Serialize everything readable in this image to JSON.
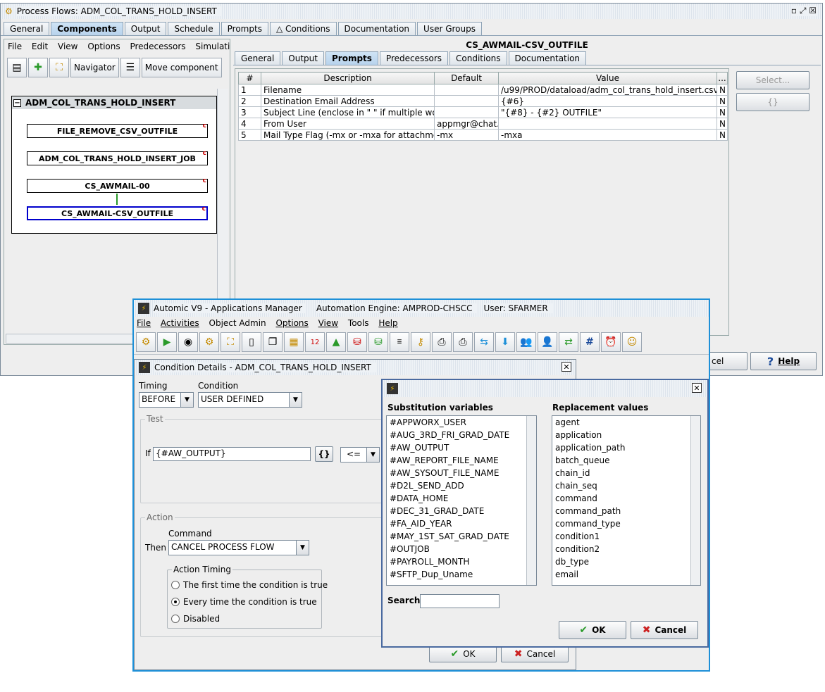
{
  "main": {
    "title": "Process Flows: ADM_COL_TRANS_HOLD_INSERT",
    "tabs": [
      "General",
      "Components",
      "Output",
      "Schedule",
      "Prompts",
      "Conditions",
      "Documentation",
      "User Groups"
    ],
    "left_menu": [
      "File",
      "Edit",
      "View",
      "Options",
      "Predecessors",
      "Simulation"
    ],
    "navigator_label": "Navigator",
    "move_label": "Move component",
    "flow_header": "ADM_COL_TRANS_HOLD_INSERT",
    "nodes": [
      "FILE_REMOVE_CSV_OUTFILE",
      "ADM_COL_TRANS_HOLD_INSERT_JOB",
      "CS_AWMAIL-00",
      "CS_AWMAIL-CSV_OUTFILE"
    ],
    "node_marker": "c",
    "right_title": "CS_AWMAIL-CSV_OUTFILE",
    "sub_tabs": [
      "General",
      "Output",
      "Prompts",
      "Predecessors",
      "Conditions",
      "Documentation"
    ],
    "columns": [
      "#",
      "Description",
      "Default",
      "Value",
      "..."
    ],
    "rows": [
      {
        "n": "1",
        "desc": "Filename",
        "def": "",
        "val": "/u99/PROD/dataload/adm_col_trans_hold_insert.csv",
        "flag": "N"
      },
      {
        "n": "2",
        "desc": "Destination Email Address",
        "def": "",
        "val": "{#6}",
        "flag": "N"
      },
      {
        "n": "3",
        "desc": "Subject Line (enclose in \"  \" if multiple word...",
        "def": "",
        "val": "\"{#8} - {#2} OUTFILE\"",
        "flag": "N"
      },
      {
        "n": "4",
        "desc": "From User",
        "def": "appmgr@chat...",
        "val": "",
        "flag": "N"
      },
      {
        "n": "5",
        "desc": "Mail Type Flag (-mx or -mxa for attachment)",
        "def": "-mx",
        "val": "-mxa",
        "flag": "N"
      }
    ],
    "select_btn": "Select...",
    "braces_btn": "{}",
    "cancel_btn": "cel",
    "help_btn": "Help"
  },
  "am": {
    "title": "Automic V9 - Applications Manager",
    "engine": "Automation Engine: AMPROD-CHSCC",
    "user": "User: SFARMER",
    "menu": [
      "File",
      "Activities",
      "Object Admin",
      "Options",
      "View",
      "Tools",
      "Help"
    ]
  },
  "cond": {
    "title": "Condition Details - ADM_COL_TRANS_HOLD_INSERT",
    "timing_label": "Timing",
    "timing_value": "BEFORE",
    "condition_label": "Condition",
    "condition_value": "USER DEFINED",
    "test_label": "Test",
    "if_label": "If",
    "if_value": "{#AW_OUTPUT}",
    "braces": "{}",
    "operator": "<=",
    "action_label": "Action",
    "command_label": "Command",
    "then_label": "Then",
    "command_value": "CANCEL PROCESS FLOW",
    "action_timing_label": "Action Timing",
    "radio": [
      "The first time the condition is true",
      "Every time the condition is true",
      "Disabled"
    ],
    "ok": "OK",
    "cancel": "Cancel"
  },
  "subst": {
    "vars_label": "Substitution variables",
    "repl_label": "Replacement values",
    "vars": [
      "#APPWORX_USER",
      "#AUG_3RD_FRI_GRAD_DATE",
      "#AW_OUTPUT",
      "#AW_REPORT_FILE_NAME",
      "#AW_SYSOUT_FILE_NAME",
      "#D2L_SEND_ADD",
      "#DATA_HOME",
      "#DEC_31_GRAD_DATE",
      "#FA_AID_YEAR",
      "#MAY_1ST_SAT_GRAD_DATE",
      "#OUTJOB",
      "#PAYROLL_MONTH",
      "#SFTP_Dup_Uname"
    ],
    "repl": [
      "agent",
      "application",
      "application_path",
      "batch_queue",
      "chain_id",
      "chain_seq",
      "command",
      "command_path",
      "command_type",
      "condition1",
      "condition2",
      "db_type",
      "email"
    ],
    "search_label": "Search",
    "ok": "OK",
    "cancel": "Cancel"
  },
  "colors": {
    "accent": "#1e90d8",
    "select_border": "#0000cc",
    "ok_check": "#2a9a2a",
    "cancel_x": "#cc2222"
  }
}
